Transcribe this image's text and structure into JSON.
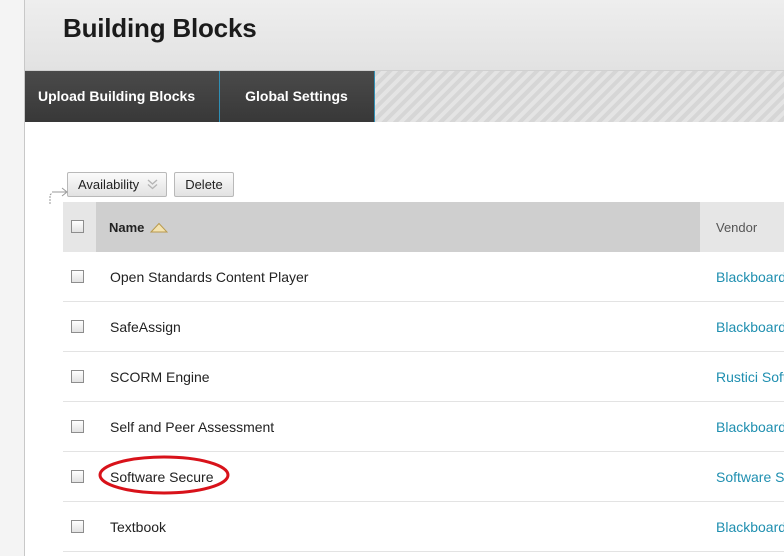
{
  "page": {
    "title": "Building Blocks"
  },
  "action_bar": {
    "tabs": [
      {
        "label": "Upload Building Blocks"
      },
      {
        "label": "Global Settings"
      }
    ]
  },
  "list_actions": {
    "availability_label": "Availability",
    "delete_label": "Delete"
  },
  "table": {
    "columns": {
      "name": "Name",
      "vendor": "Vendor"
    },
    "sort": {
      "column": "Name",
      "direction": "ascending"
    },
    "rows": [
      {
        "name": "Open Standards Content Player",
        "vendor": "Blackboard"
      },
      {
        "name": "SafeAssign",
        "vendor": "Blackboard"
      },
      {
        "name": "SCORM Engine",
        "vendor": "Rustici Software"
      },
      {
        "name": "Self and Peer Assessment",
        "vendor": "Blackboard"
      },
      {
        "name": "Software Secure",
        "vendor": "Software Secure"
      },
      {
        "name": "Textbook",
        "vendor": "Blackboard"
      }
    ]
  },
  "annotation": {
    "highlighted_row": "Software Secure",
    "color": "#d8121a"
  },
  "colors": {
    "link": "#1f8fb0",
    "tab_separator": "#2f8fb5",
    "action_bar_bg": "#3f3f3f"
  }
}
